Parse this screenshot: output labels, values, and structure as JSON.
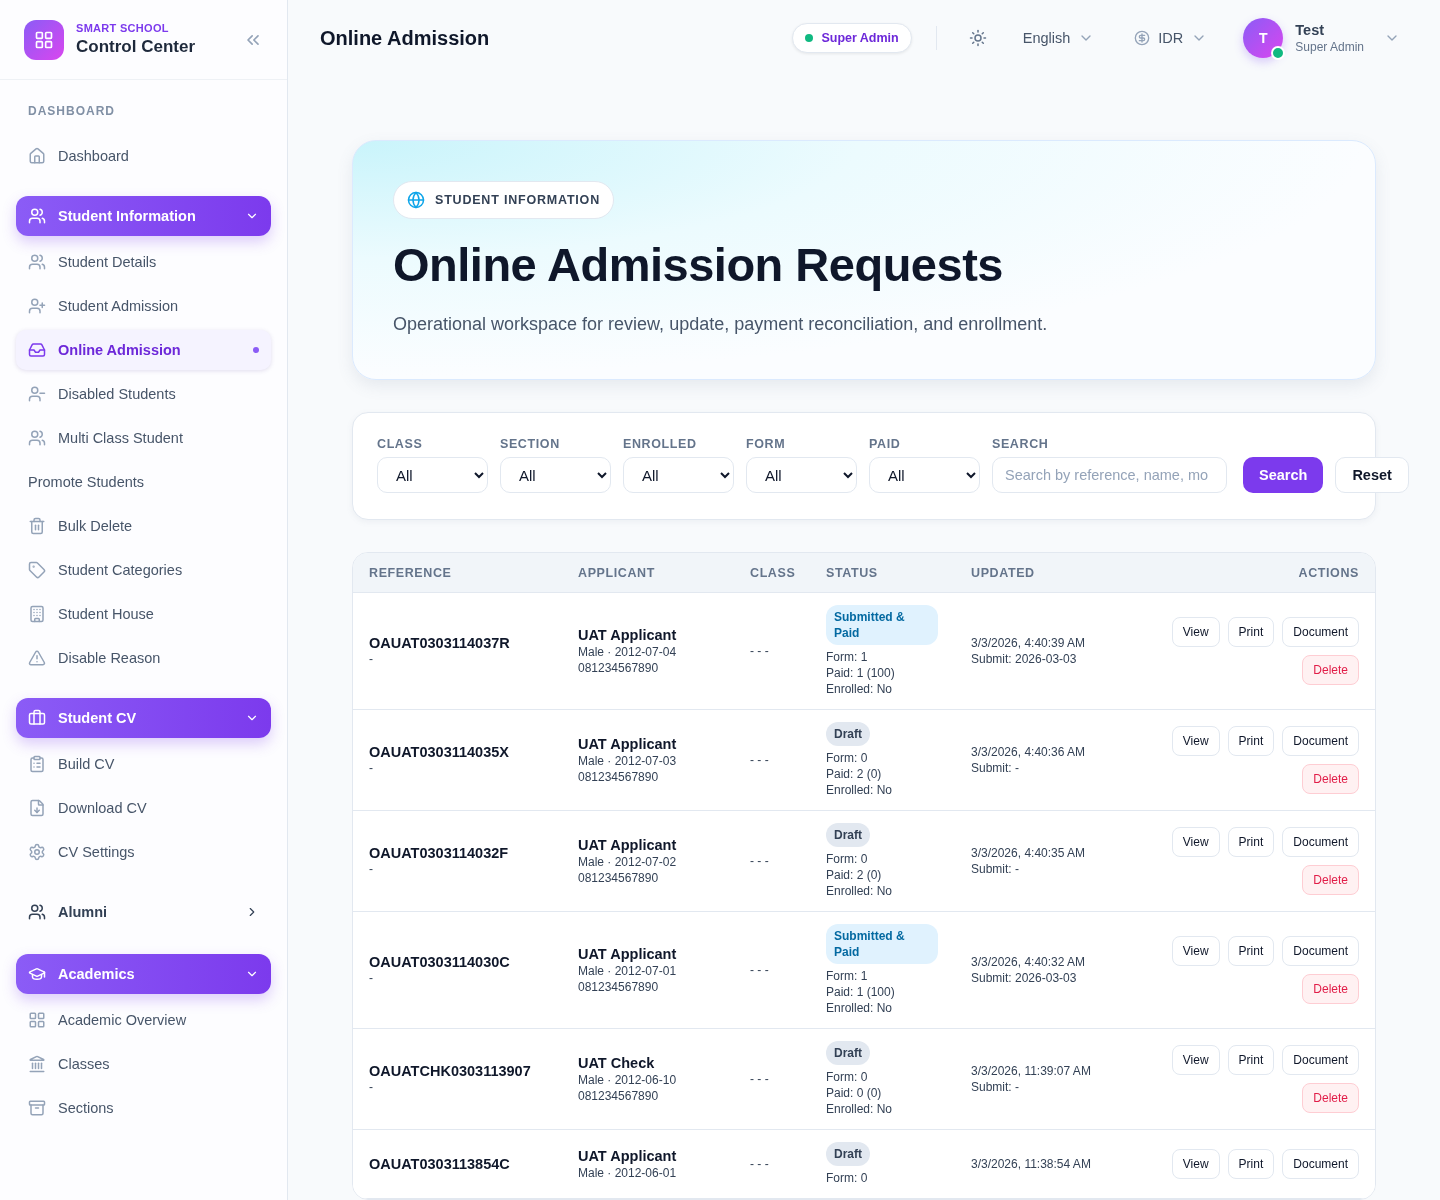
{
  "brand": {
    "eyebrow": "SMART SCHOOL",
    "title": "Control Center"
  },
  "sidebar": {
    "items": [
      {
        "kind": "heading",
        "label": "DASHBOARD"
      },
      {
        "kind": "link",
        "label": "Dashboard",
        "selected": false
      },
      {
        "kind": "group",
        "label": "Student Information",
        "expanded": true
      },
      {
        "kind": "link",
        "label": "Student Details",
        "selected": false
      },
      {
        "kind": "link",
        "label": "Student Admission",
        "selected": false
      },
      {
        "kind": "link",
        "label": "Online Admission",
        "selected": true
      },
      {
        "kind": "link",
        "label": "Disabled Students",
        "selected": false
      },
      {
        "kind": "link",
        "label": "Multi Class Student",
        "selected": false
      },
      {
        "kind": "plain",
        "label": "Promote Students"
      },
      {
        "kind": "link",
        "label": "Bulk Delete",
        "selected": false
      },
      {
        "kind": "link",
        "label": "Student Categories",
        "selected": false
      },
      {
        "kind": "link",
        "label": "Student House",
        "selected": false
      },
      {
        "kind": "link",
        "label": "Disable Reason",
        "selected": false
      },
      {
        "kind": "group",
        "label": "Student CV",
        "expanded": true
      },
      {
        "kind": "link",
        "label": "Build CV",
        "selected": false
      },
      {
        "kind": "link",
        "label": "Download CV",
        "selected": false
      },
      {
        "kind": "link",
        "label": "CV Settings",
        "selected": false
      },
      {
        "kind": "group",
        "label": "Alumni",
        "expanded": false
      },
      {
        "kind": "group",
        "label": "Academics",
        "expanded": true
      },
      {
        "kind": "link",
        "label": "Academic Overview",
        "selected": false
      },
      {
        "kind": "link",
        "label": "Classes",
        "selected": false
      },
      {
        "kind": "link",
        "label": "Sections",
        "selected": false
      }
    ]
  },
  "topbar": {
    "title": "Online Admission",
    "role_badge": "Super Admin",
    "language": "English",
    "currency": "IDR",
    "user": {
      "initial": "T",
      "name": "Test",
      "role": "Super Admin",
      "online": true
    }
  },
  "hero": {
    "badge": "STUDENT INFORMATION",
    "title": "Online Admission Requests",
    "subtitle": "Operational workspace for review, update, payment reconciliation, and enrollment."
  },
  "filters": {
    "selects": [
      {
        "label": "CLASS",
        "value": "All"
      },
      {
        "label": "SECTION",
        "value": "All"
      },
      {
        "label": "ENROLLED",
        "value": "All"
      },
      {
        "label": "FORM",
        "value": "All"
      },
      {
        "label": "PAID",
        "value": "All"
      }
    ],
    "search": {
      "label": "SEARCH",
      "placeholder": "Search by reference, name, mo"
    },
    "buttons": [
      "Search",
      "Reset"
    ]
  },
  "table": {
    "columns": [
      "REFERENCE",
      "APPLICANT",
      "CLASS",
      "STATUS",
      "UPDATED",
      "ACTIONS"
    ],
    "rows": [
      {
        "reference": "OAUAT0303114037R",
        "reference_note": "-",
        "name": "UAT Applicant",
        "details": [
          "Male · 2012-07-04",
          "081234567890"
        ],
        "class": "- - -",
        "status": {
          "kind": "paid",
          "label": "Submitted & Paid"
        },
        "status_lines": [
          "Form: 1",
          "Paid: 1 (100)",
          "Enrolled: No"
        ],
        "updated": [
          "3/3/2026, 4:40:39 AM",
          "Submit: 2026-03-03"
        ],
        "actions": [
          "View",
          "Print",
          "Document"
        ],
        "delete": "Delete"
      },
      {
        "reference": "OAUAT0303114035X",
        "reference_note": "-",
        "name": "UAT Applicant",
        "details": [
          "Male · 2012-07-03",
          "081234567890"
        ],
        "class": "- - -",
        "status": {
          "kind": "draft",
          "label": "Draft"
        },
        "status_lines": [
          "Form: 0",
          "Paid: 2 (0)",
          "Enrolled: No"
        ],
        "updated": [
          "3/3/2026, 4:40:36 AM",
          "Submit: -"
        ],
        "actions": [
          "View",
          "Print",
          "Document"
        ],
        "delete": "Delete"
      },
      {
        "reference": "OAUAT0303114032F",
        "reference_note": "-",
        "name": "UAT Applicant",
        "details": [
          "Male · 2012-07-02",
          "081234567890"
        ],
        "class": "- - -",
        "status": {
          "kind": "draft",
          "label": "Draft"
        },
        "status_lines": [
          "Form: 0",
          "Paid: 2 (0)",
          "Enrolled: No"
        ],
        "updated": [
          "3/3/2026, 4:40:35 AM",
          "Submit: -"
        ],
        "actions": [
          "View",
          "Print",
          "Document"
        ],
        "delete": "Delete"
      },
      {
        "reference": "OAUAT0303114030C",
        "reference_note": "-",
        "name": "UAT Applicant",
        "details": [
          "Male · 2012-07-01",
          "081234567890"
        ],
        "class": "- - -",
        "status": {
          "kind": "paid",
          "label": "Submitted & Paid"
        },
        "status_lines": [
          "Form: 1",
          "Paid: 1 (100)",
          "Enrolled: No"
        ],
        "updated": [
          "3/3/2026, 4:40:32 AM",
          "Submit: 2026-03-03"
        ],
        "actions": [
          "View",
          "Print",
          "Document"
        ],
        "delete": "Delete"
      },
      {
        "reference": "OAUATCHK0303113907",
        "reference_note": "-",
        "name": "UAT Check",
        "details": [
          "Male · 2012-06-10",
          "081234567890"
        ],
        "class": "- - -",
        "status": {
          "kind": "draft",
          "label": "Draft"
        },
        "status_lines": [
          "Form: 0",
          "Paid: 0 (0)",
          "Enrolled: No"
        ],
        "updated": [
          "3/3/2026, 11:39:07 AM",
          "Submit: -"
        ],
        "actions": [
          "View",
          "Print",
          "Document"
        ],
        "delete": "Delete"
      },
      {
        "reference": "OAUAT0303113854C",
        "name": "UAT Applicant",
        "details": [
          "Male · 2012-06-01"
        ],
        "class": "- - -",
        "status": {
          "kind": "draft",
          "label": "Draft"
        },
        "status_lines": [
          "Form: 0"
        ],
        "updated": [
          "3/3/2026, 11:38:54 AM"
        ],
        "actions": [
          "View",
          "Print",
          "Document"
        ]
      }
    ]
  }
}
